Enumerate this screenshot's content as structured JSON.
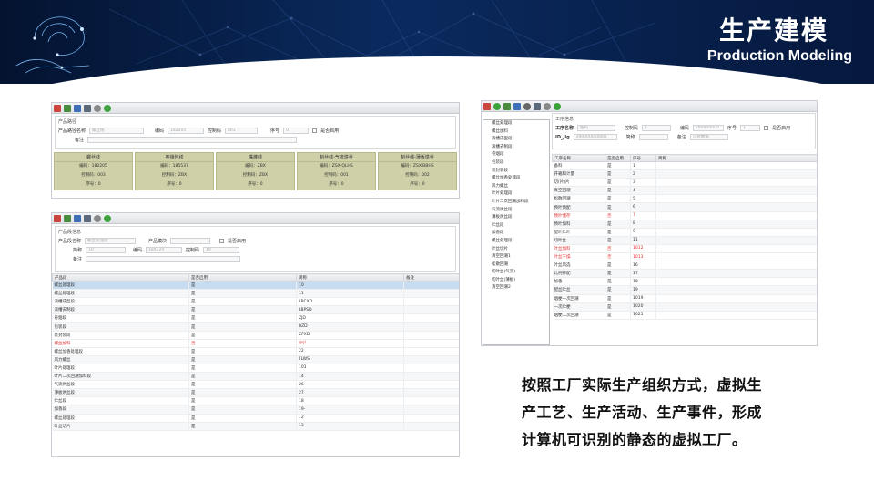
{
  "header": {
    "title_cn": "生产建模",
    "title_en": "Production Modeling"
  },
  "win1": {
    "group_label": "产品路径",
    "fields": [
      {
        "label": "产品路径名称",
        "value": "螺丝线"
      },
      {
        "label": "编码",
        "value": "182205"
      },
      {
        "label": "控制码",
        "value": "003"
      },
      {
        "label": "序号",
        "value": "0"
      },
      {
        "label": "是否启用",
        "value": ""
      }
    ],
    "remark_label": "备注",
    "cards": [
      {
        "title": "螺丝线",
        "lines": [
          "编码：182205",
          "控制码：003",
          "序号：0"
        ]
      },
      {
        "title": "卷接包线",
        "lines": [
          "编码：185537",
          "控制码：ZBX",
          "序号：0"
        ]
      },
      {
        "title": "嘴棒线",
        "lines": [
          "编码：ZBX",
          "控制码：ZBX",
          "序号：0"
        ]
      },
      {
        "title": "制丝线-气流烘丝",
        "lines": [
          "编码：ZSX-QLHS",
          "控制码：001",
          "序号：0"
        ]
      },
      {
        "title": "制丝线-薄板烘丝",
        "lines": [
          "编码：ZSX-BBHS",
          "控制码：002",
          "序号：0"
        ]
      }
    ]
  },
  "win2": {
    "group_label": "产品段信息",
    "fields": {
      "name_label": "产品段名称",
      "name_value": "螺丝处理段",
      "module_label": "产品模块",
      "module_value": "",
      "enabled_label": "是否启用",
      "short_label": "简称",
      "short_value": "10",
      "code_label": "编码",
      "code_value": "184224",
      "ctrl_label": "控制码",
      "ctrl_value": "10",
      "remark_label": "备注"
    },
    "columns": [
      "产品段",
      "是否启用",
      "简称",
      "备注"
    ],
    "rows": [
      {
        "c": [
          "螺丝处理段",
          "是",
          "10",
          ""
        ],
        "t": "sel"
      },
      {
        "c": [
          "螺丝处理段",
          "是",
          "11",
          ""
        ],
        "t": ""
      },
      {
        "c": [
          "滚槽成型段",
          "是",
          "LBCXD",
          ""
        ],
        "t": ""
      },
      {
        "c": [
          "滚槽去制段",
          "是",
          "LBPSD",
          ""
        ],
        "t": ""
      },
      {
        "c": [
          "卷烟段",
          "是",
          "ZJD",
          ""
        ],
        "t": ""
      },
      {
        "c": [
          "包装段",
          "是",
          "BZD",
          ""
        ],
        "t": ""
      },
      {
        "c": [
          "装封装段",
          "是",
          "ZFXD",
          ""
        ],
        "t": ""
      },
      {
        "c": [
          "螺丝加料",
          "否",
          "gsjl",
          ""
        ],
        "t": "red"
      },
      {
        "c": [
          "螺丝加香处理段",
          "是",
          "22",
          ""
        ],
        "t": ""
      },
      {
        "c": [
          "风力螺丝",
          "是",
          "FLWS",
          ""
        ],
        "t": ""
      },
      {
        "c": [
          "叶片处理段",
          "是",
          "101",
          ""
        ],
        "t": ""
      },
      {
        "c": [
          "叶片二次回潮加料段",
          "是",
          "14",
          ""
        ],
        "t": ""
      },
      {
        "c": [
          "气流烘丝段",
          "是",
          "26",
          ""
        ],
        "t": ""
      },
      {
        "c": [
          "薄板烘丝段",
          "是",
          "27",
          ""
        ],
        "t": ""
      },
      {
        "c": [
          "贮丝段",
          "是",
          "18",
          ""
        ],
        "t": ""
      },
      {
        "c": [
          "加香段",
          "是",
          "19-",
          ""
        ],
        "t": ""
      },
      {
        "c": [
          "螺丝处理段",
          "是",
          "12",
          ""
        ],
        "t": ""
      },
      {
        "c": [
          "叶丝切片",
          "是",
          "13",
          ""
        ],
        "t": ""
      }
    ]
  },
  "win3": {
    "group_label": "工序信息",
    "fields": {
      "name_label": "工序名称",
      "name_value": "备料",
      "ctrl_label": "控制码",
      "ctrl_value": "1",
      "code_label": "编码",
      "code_value": "290050000",
      "seq_label": "序号",
      "seq_value": "1",
      "enabled_label": "是否启用",
      "id_label": "ID_Jlg",
      "id_value": "290000000001",
      "short_label": "简称",
      "short_value": "",
      "remark_label": "备注",
      "remark_value": "正式数据"
    },
    "side_items": [
      "螺丝处理段",
      "螺丝加料",
      "滚槽成型段",
      "滚槽去制段",
      "卷烟段",
      "包装段",
      "装封装段",
      "螺丝加香处理段",
      "风力螺丝",
      "叶片处理段",
      "叶片二次回潮加料段",
      "气流烘丝段",
      "薄板烘丝段",
      "贮丝段",
      "加香段",
      "螺丝处理段",
      "叶丝切片",
      "真空回潮1",
      "松散回潮",
      "切叶丝(气流)",
      "切叶丝(薄板)",
      "真空回潮2"
    ],
    "columns": [
      "工序名称",
      "是否启用",
      "序号",
      "简称"
    ],
    "rows": [
      {
        "c": [
          "备料",
          "是",
          "1",
          ""
        ],
        "t": ""
      },
      {
        "c": [
          "开箱和计量",
          "是",
          "2",
          ""
        ],
        "t": ""
      },
      {
        "c": [
          "切(片)片",
          "是",
          "3",
          ""
        ],
        "t": ""
      },
      {
        "c": [
          "真空回潮",
          "是",
          "4",
          ""
        ],
        "t": ""
      },
      {
        "c": [
          "松散回潮",
          "是",
          "5",
          ""
        ],
        "t": ""
      },
      {
        "c": [
          "预叶预配",
          "是",
          "6",
          ""
        ],
        "t": ""
      },
      {
        "c": [
          "预叶储存",
          "否",
          "7",
          ""
        ],
        "t": "red"
      },
      {
        "c": [
          "预叶加料",
          "是",
          "8",
          ""
        ],
        "t": ""
      },
      {
        "c": [
          "配叶贮叶",
          "是",
          "9",
          ""
        ],
        "t": ""
      },
      {
        "c": [
          "切叶丝",
          "是",
          "11",
          ""
        ],
        "t": ""
      },
      {
        "c": [
          "叶丝加料",
          "否",
          "1012",
          ""
        ],
        "t": "red"
      },
      {
        "c": [
          "叶丝干燥",
          "否",
          "1013",
          ""
        ],
        "t": "red"
      },
      {
        "c": [
          "叶丝风选",
          "是",
          "16",
          ""
        ],
        "t": ""
      },
      {
        "c": [
          "比例掺配",
          "是",
          "17",
          ""
        ],
        "t": ""
      },
      {
        "c": [
          "加香",
          "是",
          "18",
          ""
        ],
        "t": ""
      },
      {
        "c": [
          "配丝贮丝",
          "是",
          "19",
          ""
        ],
        "t": ""
      },
      {
        "c": [
          "烟梗一次回潮",
          "是",
          "1019",
          ""
        ],
        "t": ""
      },
      {
        "c": [
          "一次贮梗",
          "是",
          "1020",
          ""
        ],
        "t": ""
      },
      {
        "c": [
          "烟梗二次回潮",
          "是",
          "1021",
          ""
        ],
        "t": ""
      }
    ]
  },
  "caption": {
    "line1": "按照工厂实际生产组织方式，虚拟生",
    "line2": "产工艺、生产活动、生产事件，形成",
    "line3": "计算机可识别的静态的虚拟工厂。"
  }
}
